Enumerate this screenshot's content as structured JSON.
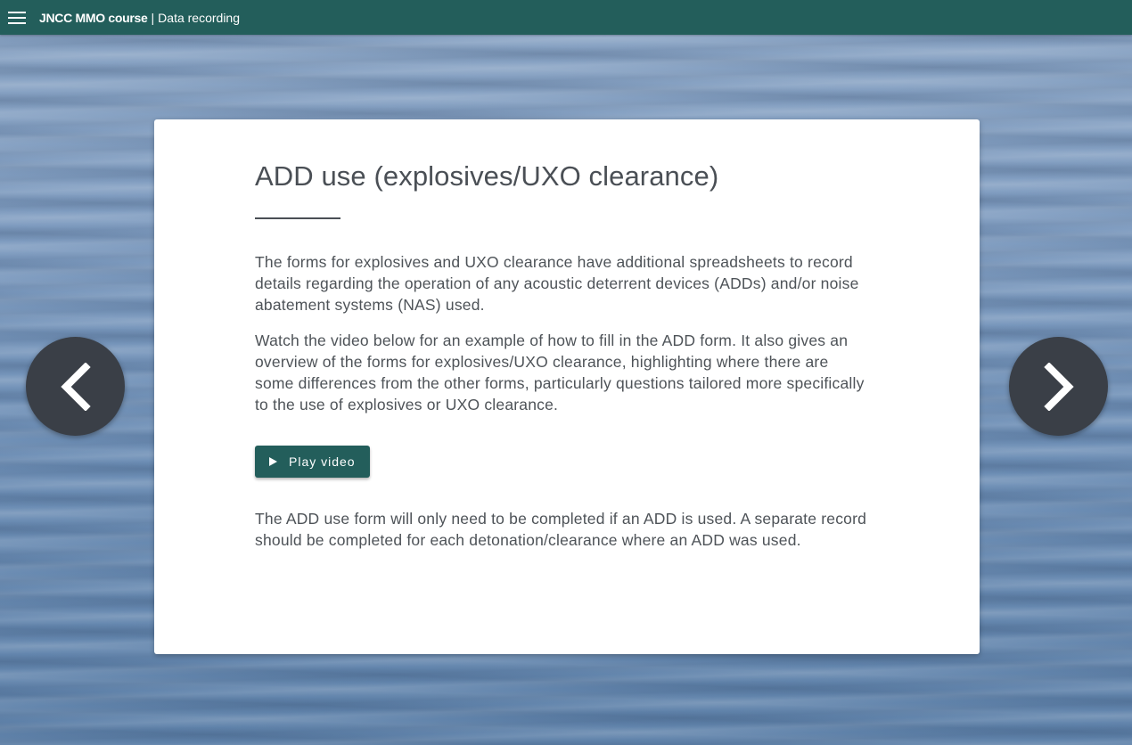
{
  "header": {
    "app_title": "JNCC MMO course",
    "separator": "|",
    "page_title": "Data recording"
  },
  "content": {
    "heading": "ADD use (explosives/UXO clearance)",
    "paragraphs": [
      "The forms for explosives and UXO clearance have additional spreadsheets to record details regarding the operation of any acoustic deterrent devices (ADDs) and/or noise abatement systems (NAS) used.",
      "Watch the video below for an example of how to fill in the ADD form. It also gives an overview of the forms for explosives/UXO clearance, highlighting where there are some differences from the other forms, particularly questions tailored more specifically to the use of explosives or UXO clearance.",
      "The ADD use form will only need to be completed if an ADD is used. A separate record should be completed for each detonation/clearance where an ADD was used."
    ],
    "play_button_label": "Play video"
  },
  "navigation": {
    "prev_icon": "chevron-left-icon",
    "next_icon": "chevron-right-icon"
  },
  "colors": {
    "accent": "#235e5b",
    "nav_button": "#3a3f47",
    "text": "#4e5358"
  }
}
